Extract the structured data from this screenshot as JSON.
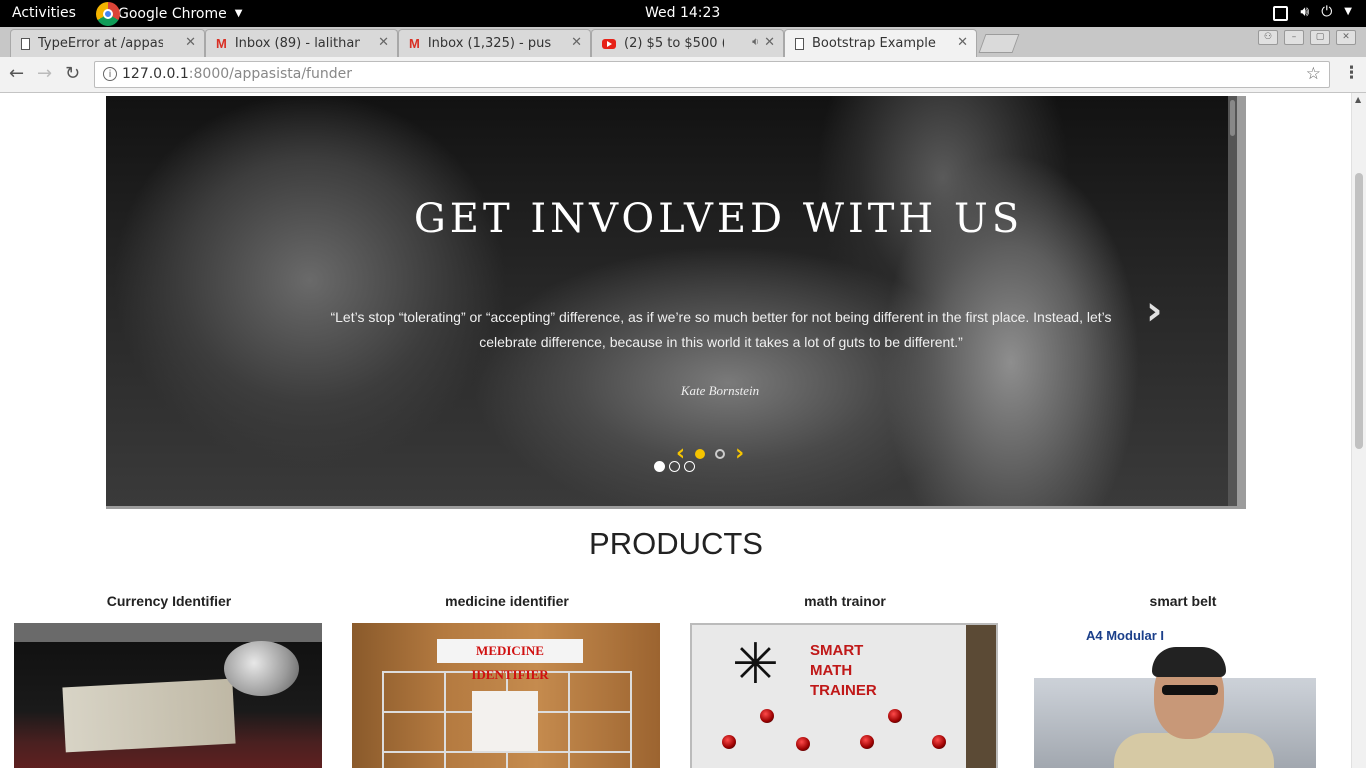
{
  "system_bar": {
    "activities": "Activities",
    "app_name": "Google Chrome",
    "clock": "Wed 14:23",
    "tray_icons": [
      "window-icon",
      "volume-icon",
      "power-icon"
    ]
  },
  "tabs": [
    {
      "title": "TypeError at /appas",
      "favicon": "document-icon",
      "active": false
    },
    {
      "title": "Inbox (89) - lalithan",
      "favicon": "gmail-icon",
      "active": false
    },
    {
      "title": "Inbox (1,325) - pus",
      "favicon": "gmail-icon",
      "active": false
    },
    {
      "title": "(2) $5 to $500 (",
      "favicon": "youtube-icon",
      "active": false,
      "audio": true
    },
    {
      "title": "Bootstrap Example",
      "favicon": "document-icon",
      "active": true
    }
  ],
  "address_bar": {
    "host": "127.0.0.1",
    "rest": ":8000/appasista/funder"
  },
  "carousel": {
    "headline": "GET INVOLVED WITH US",
    "quote": "“Let’s stop “tolerating” or “accepting” difference, as if we’re so much better for not being different in the first place. Instead, let’s celebrate difference, because in this world it takes a lot of guts to be different.”",
    "author": "Kate Bornstein",
    "slide_count": 3,
    "active_slide": 1
  },
  "products": {
    "title": "PRODUCTS",
    "items": [
      {
        "name": "Currency Identifier"
      },
      {
        "name": "medicine identifier",
        "image_label": "MEDICINE IDENTIFIER"
      },
      {
        "name": "math trainor",
        "image_label": "SMART\nMATH\nTRAINER"
      },
      {
        "name": "smart belt",
        "image_label": "A4   Modular I"
      }
    ]
  },
  "colors": {
    "accent_yellow": "#f5c400",
    "system_bar": "#000000",
    "medicine_label_red": "#d01010"
  }
}
